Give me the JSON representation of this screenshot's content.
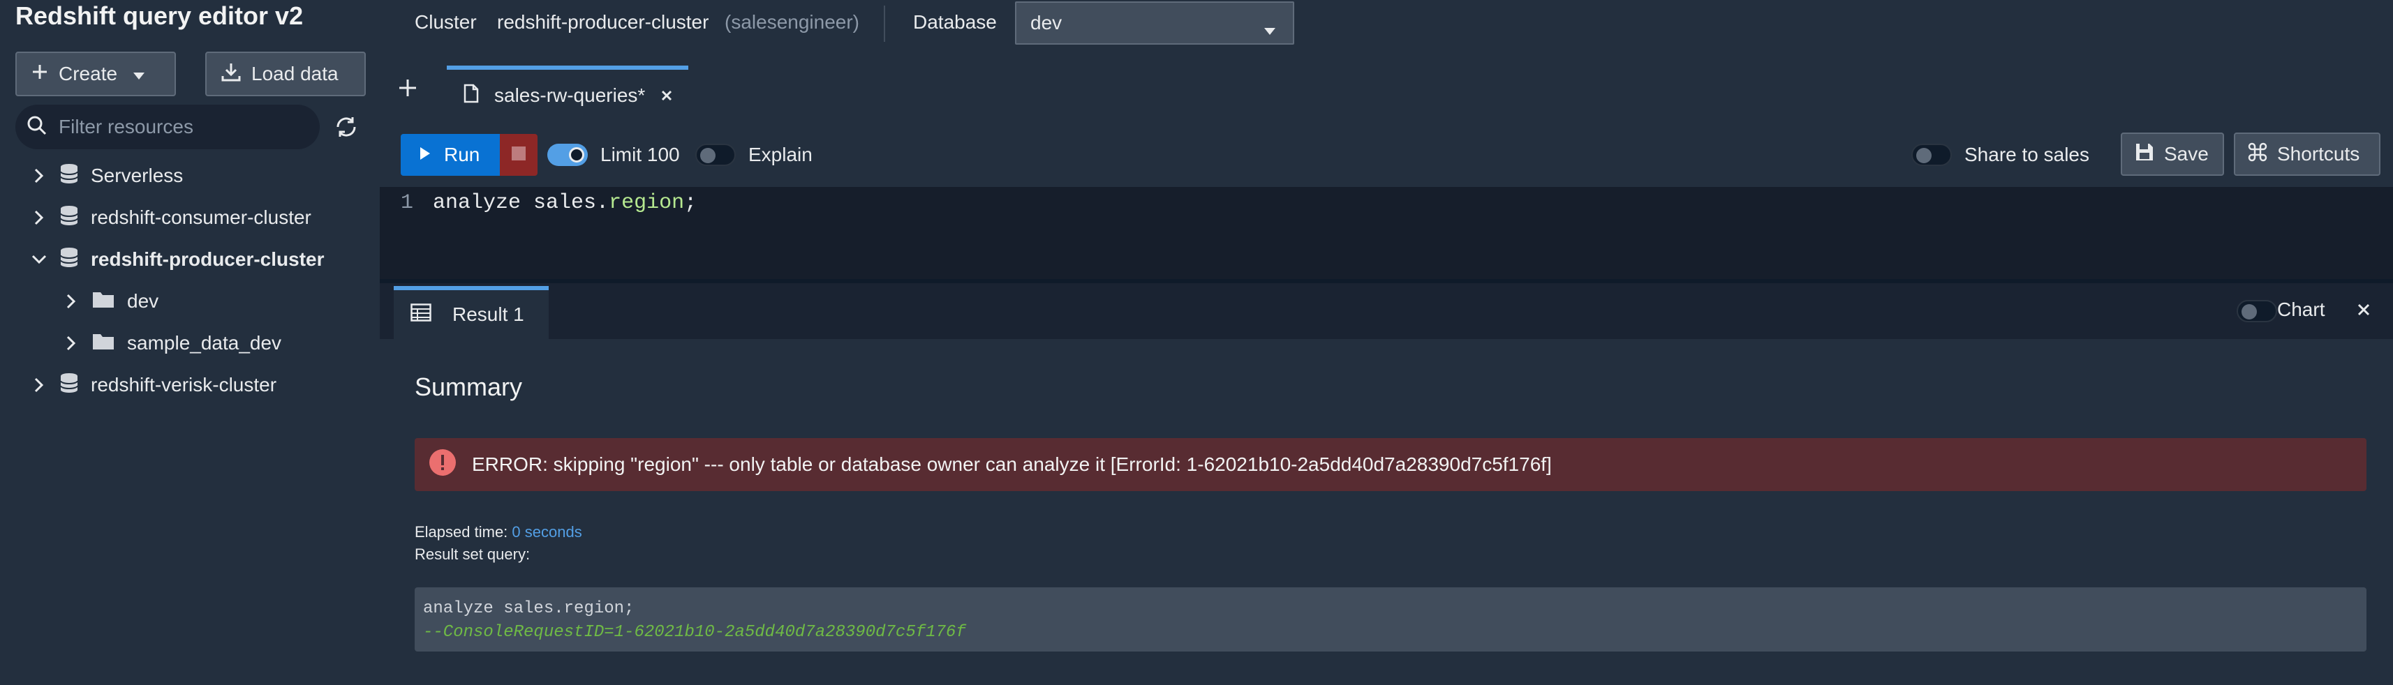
{
  "sidebar": {
    "title": "Redshift query editor v2",
    "create_label": "Create",
    "load_label": "Load data",
    "filter_placeholder": "Filter resources",
    "tree": [
      {
        "label": "Serverless",
        "expanded": false,
        "icon": "database-icon"
      },
      {
        "label": "redshift-consumer-cluster",
        "expanded": false,
        "icon": "database-icon"
      },
      {
        "label": "redshift-producer-cluster",
        "expanded": true,
        "icon": "database-icon"
      },
      {
        "label": "dev",
        "expanded": false,
        "icon": "folder-icon"
      },
      {
        "label": "sample_data_dev",
        "expanded": false,
        "icon": "folder-icon"
      },
      {
        "label": "redshift-verisk-cluster",
        "expanded": false,
        "icon": "database-icon"
      }
    ]
  },
  "topbar": {
    "cluster_label": "Cluster",
    "cluster_value": "redshift-producer-cluster",
    "cluster_user": "(salesengineer)",
    "database_label": "Database",
    "database_value": "dev"
  },
  "tabs": [
    {
      "label": "sales-rw-queries*"
    }
  ],
  "toolbar": {
    "run_label": "Run",
    "limit_label": "Limit 100",
    "limit_enabled": true,
    "explain_label": "Explain",
    "explain_enabled": false,
    "share_label": "Share to sales",
    "share_enabled": false,
    "save_label": "Save",
    "shortcuts_label": "Shortcuts"
  },
  "editor": {
    "line_number": "1",
    "code_prefix": "analyze sales",
    "code_dot": ".",
    "code_prop": "region",
    "code_suffix": ";"
  },
  "result": {
    "tab_label": "Result 1",
    "chart_label": "Chart",
    "chart_enabled": false,
    "summary_title": "Summary",
    "error_text": "ERROR: skipping \"region\" --- only table or database owner can analyze it [ErrorId: 1-62021b10-2a5dd40d7a28390d7c5f176f]",
    "elapsed_label": "Elapsed time:",
    "elapsed_value": "0 seconds",
    "result_set_label": "Result set query:",
    "query_line": "analyze sales.region;",
    "query_comment": "--ConsoleRequestID=1-62021b10-2a5dd40d7a28390d7c5f176f"
  },
  "colors": {
    "accent": "#539fe5",
    "run_button": "#0972d3",
    "error_bg": "#582c32",
    "error_icon": "#eb6f6f"
  }
}
